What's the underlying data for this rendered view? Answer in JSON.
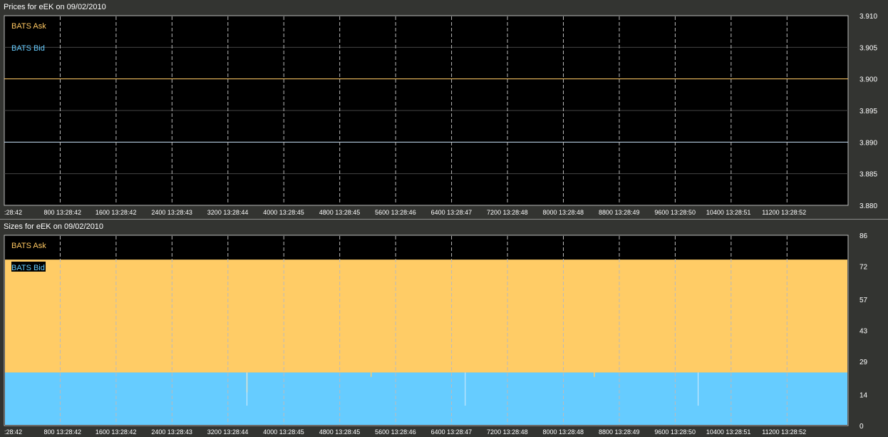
{
  "chart_data": [
    {
      "type": "line",
      "title": "Prices for  eEK  on  09/02/2010",
      "ylim": [
        3.88,
        3.91
      ],
      "yticks": [
        "3.910",
        "3.905",
        "3.900",
        "3.895",
        "3.890",
        "3.885",
        "3.880"
      ],
      "ytick_values": [
        3.91,
        3.905,
        3.9,
        3.895,
        3.89,
        3.885,
        3.88
      ],
      "xticks": [
        ":28:42",
        "800 13:28:42",
        "1600 13:28:42",
        "2400 13:28:43",
        "3200 13:28:44",
        "4000 13:28:45",
        "4800 13:28:45",
        "5600 13:28:46",
        "6400 13:28:47",
        "7200 13:28:48",
        "8000 13:28:48",
        "8800 13:28:49",
        "9600 13:28:50",
        "10400 13:28:51",
        "11200 13:28:52"
      ],
      "xlim": [
        0,
        12100
      ],
      "series": [
        {
          "name": "BATS Ask",
          "color": "#ffc861",
          "x": [
            0,
            12100
          ],
          "y": [
            3.9,
            3.9
          ]
        },
        {
          "name": "BATS Bid",
          "color": "#c0d8f0",
          "x": [
            0,
            12100
          ],
          "y": [
            3.89,
            3.89
          ]
        }
      ],
      "legend": "top-left",
      "grid": true
    },
    {
      "type": "area",
      "stacked": true,
      "title": "Sizes for  eEK  on  09/02/2010",
      "ylim": [
        0,
        86
      ],
      "yticks": [
        "86",
        "72",
        "57",
        "43",
        "29",
        "14",
        "0"
      ],
      "ytick_values": [
        86,
        72,
        57,
        43,
        29,
        14,
        0
      ],
      "xticks": [
        ":28:42",
        "800 13:28:42",
        "1600 13:28:42",
        "2400 13:28:43",
        "3200 13:28:44",
        "4000 13:28:45",
        "4800 13:28:45",
        "5600 13:28:46",
        "6400 13:28:47",
        "7200 13:28:48",
        "8000 13:28:48",
        "8800 13:28:49",
        "9600 13:28:50",
        "10400 13:28:51",
        "11200 13:28:52"
      ],
      "xlim": [
        0,
        12100
      ],
      "series": [
        {
          "name": "BATS Bid",
          "color": "#66ccff",
          "base": 24,
          "dips": [
            {
              "x": 3480,
              "value": 15
            },
            {
              "x": 6610,
              "value": 15
            },
            {
              "x": 9950,
              "value": 15
            }
          ]
        },
        {
          "name": "BATS Ask",
          "color": "#ffcc66",
          "base": 51,
          "dips_in_bid": [
            {
              "x": 3480,
              "value": 9
            },
            {
              "x": 5260,
              "value": 2
            },
            {
              "x": 8460,
              "value": 2
            }
          ]
        }
      ],
      "legend": "top-left",
      "grid": true
    }
  ]
}
